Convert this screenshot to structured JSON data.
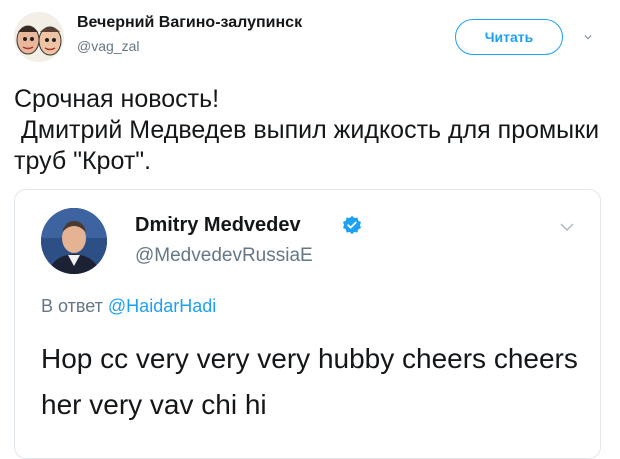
{
  "tweet": {
    "author_name": "Вечерний Вагино-залупинск",
    "author_handle": "@vag_zal",
    "follow_label": "Читать",
    "text": "Срочная новость!\n Дмитрий Медведев выпил жидкость для промыки труб \"Крот\"."
  },
  "quoted": {
    "author_name": "Dmitry Medvedev",
    "author_handle": "@MedvedevRussiaE",
    "reply_prefix": "В ответ",
    "reply_mention": "@HaidarHadi",
    "text": "Hop cc very very very hubby cheers cheers her very vav chi hi"
  },
  "icons": {
    "menu_caret": "chevron-down-icon",
    "verified": "verified-badge-icon"
  },
  "colors": {
    "accent": "#1da1f2",
    "muted": "#657786",
    "text": "#14171a",
    "border": "#e1e8ed"
  }
}
